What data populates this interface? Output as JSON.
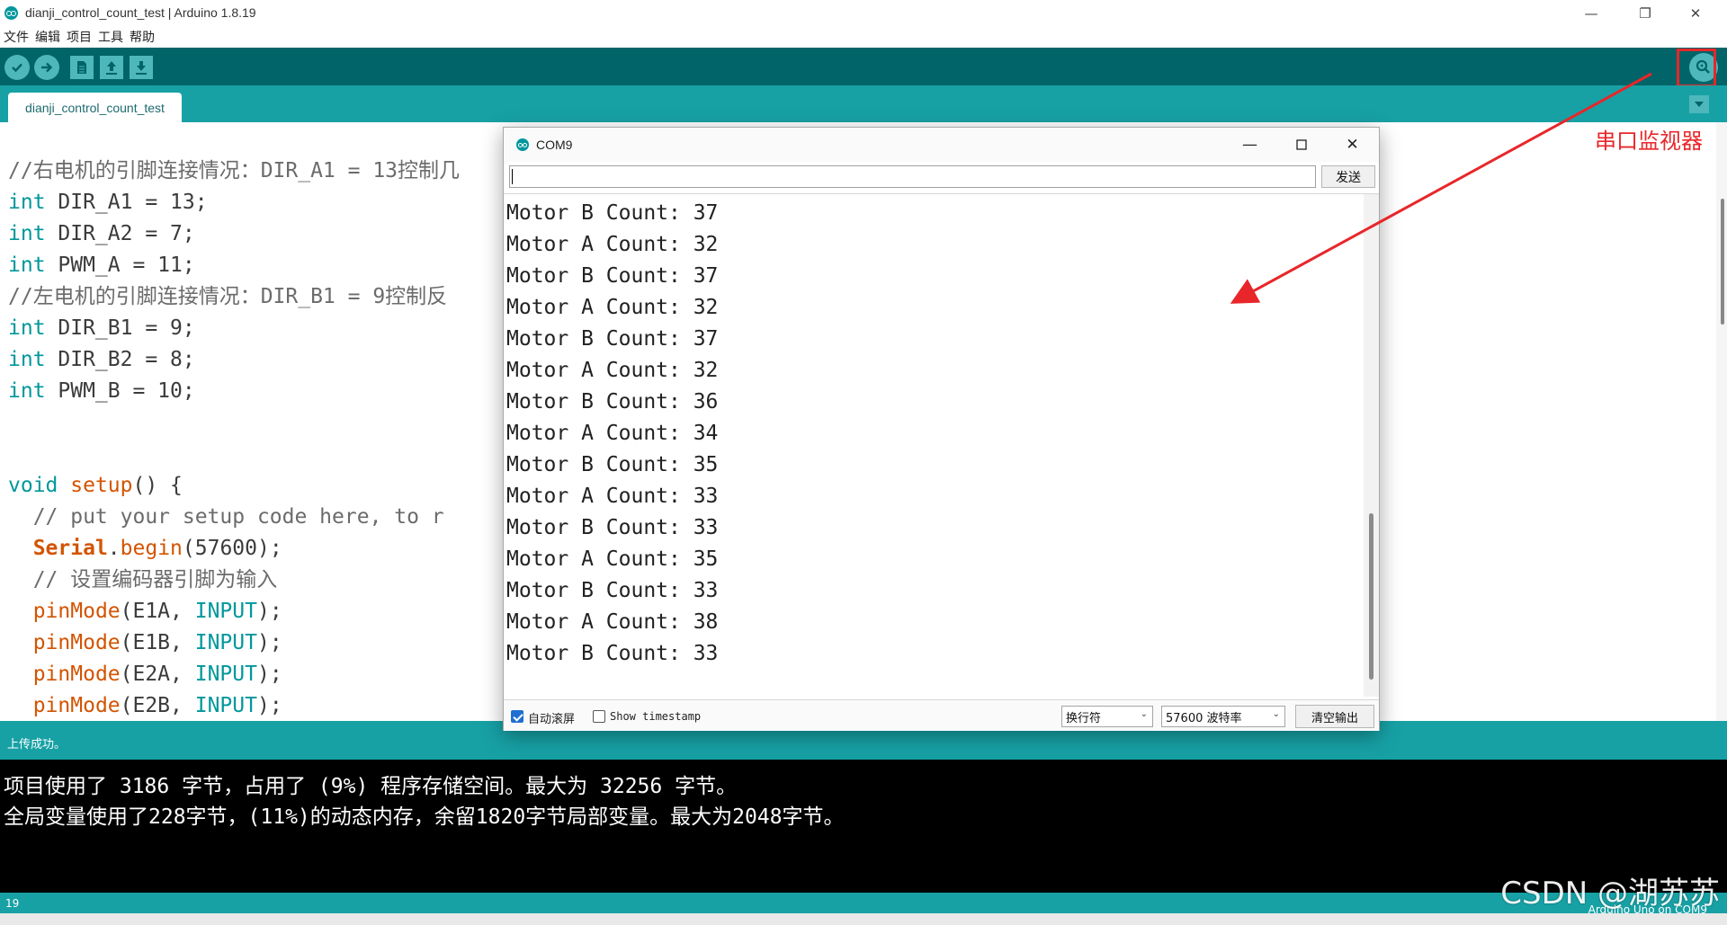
{
  "window": {
    "title": "dianji_control_count_test | Arduino 1.8.19",
    "minimize": "—",
    "maximize": "❐",
    "close": "✕"
  },
  "menu": [
    "文件",
    "编辑",
    "项目",
    "工具",
    "帮助"
  ],
  "toolbar": {
    "buttons": [
      "verify-icon",
      "upload-icon",
      "new-icon",
      "open-icon",
      "save-icon"
    ],
    "serial_monitor_icon": "serial-monitor-icon"
  },
  "tab": {
    "name": "dianji_control_count_test"
  },
  "annotation": {
    "label": "串口监视器",
    "color": "#e8262a"
  },
  "code_lines": [
    {
      "t": "//右电机的引脚连接情况：DIR_A1 = 13控制几",
      "k": "comment"
    },
    {
      "pre": "int",
      "rest": " DIR_A1 = 13;"
    },
    {
      "pre": "int",
      "rest": " DIR_A2 = 7;"
    },
    {
      "pre": "int",
      "rest": " PWM_A = 11;"
    },
    {
      "t": "//左电机的引脚连接情况：DIR_B1 = 9控制反",
      "k": "comment"
    },
    {
      "pre": "int",
      "rest": " DIR_B1 = 9;"
    },
    {
      "pre": "int",
      "rest": " DIR_B2 = 8;"
    },
    {
      "pre": "int",
      "rest": " PWM_B = 10;"
    },
    {
      "t": "",
      "k": "blank"
    },
    {
      "t": "",
      "k": "blank"
    },
    {
      "k": "setup",
      "a": "void",
      "b": " ",
      "c": "setup",
      "d": "() {"
    },
    {
      "t": "  // put your setup code here, to r",
      "k": "comment"
    },
    {
      "k": "serial",
      "a": "  ",
      "b": "Serial",
      "c": ".",
      "d": "begin",
      "e": "(57600);"
    },
    {
      "t": "  // 设置编码器引脚为输入",
      "k": "comment"
    },
    {
      "k": "pin",
      "fn": "pinMode",
      "arg": "E1A",
      "c": "INPUT"
    },
    {
      "k": "pin",
      "fn": "pinMode",
      "arg": "E1B",
      "c": "INPUT"
    },
    {
      "k": "pin",
      "fn": "pinMode",
      "arg": "E2A",
      "c": "INPUT"
    },
    {
      "k": "pin",
      "fn": "pinMode",
      "arg": "E2B",
      "c": "INPUT"
    }
  ],
  "serial_monitor": {
    "title": "COM9",
    "input_value": "",
    "send_label": "发送",
    "output": [
      "Motor B Count: 37",
      "Motor A Count: 32",
      "Motor B Count: 37",
      "Motor A Count: 32",
      "Motor B Count: 37",
      "Motor A Count: 32",
      "Motor B Count: 36",
      "Motor A Count: 34",
      "Motor B Count: 35",
      "Motor A Count: 33",
      "Motor B Count: 33",
      "Motor A Count: 35",
      "Motor B Count: 33",
      "Motor A Count: 38",
      "Motor B Count: 33"
    ],
    "autoscroll_label": "自动滚屏",
    "autoscroll_checked": true,
    "timestamp_label": "Show timestamp",
    "timestamp_checked": false,
    "line_ending": "换行符",
    "baud": "57600 波特率",
    "clear_label": "清空输出"
  },
  "status": {
    "message": "上传成功。"
  },
  "console": [
    "项目使用了 3186 字节，占用了 (9%) 程序存储空间。最大为 32256 字节。",
    "全局变量使用了228字节，(11%)的动态内存，余留1820字节局部变量。最大为2048字节。"
  ],
  "footer": {
    "line_number": "19",
    "board": "Arduino Uno on COM9"
  },
  "watermark": "CSDN @湖苏苏",
  "colors": {
    "toolbar": "#006468",
    "accent": "#17a1a5",
    "button": "#4db7bb",
    "highlight": "#e8262a"
  }
}
